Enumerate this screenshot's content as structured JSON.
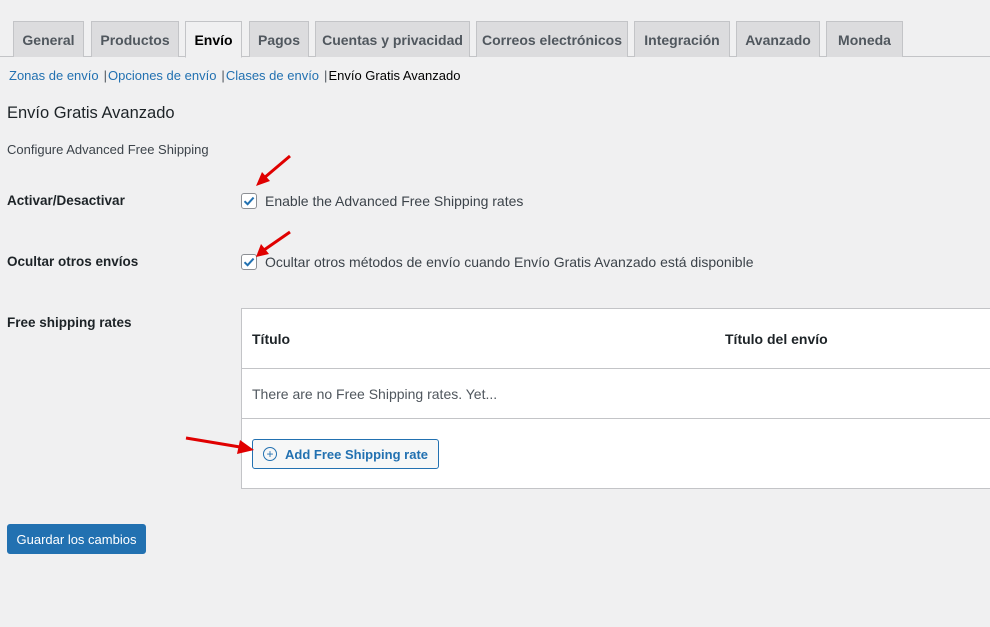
{
  "tabs": [
    {
      "label": "General"
    },
    {
      "label": "Productos"
    },
    {
      "label": "Envío"
    },
    {
      "label": "Pagos"
    },
    {
      "label": "Cuentas y privacidad"
    },
    {
      "label": "Correos electrónicos"
    },
    {
      "label": "Integración"
    },
    {
      "label": "Avanzado"
    },
    {
      "label": "Moneda"
    }
  ],
  "subnav": {
    "zones": "Zonas de envío",
    "options": "Opciones de envío",
    "classes": "Clases de envío",
    "current": "Envío Gratis Avanzado",
    "separator": "|"
  },
  "page": {
    "title": "Envío Gratis Avanzado",
    "description": "Configure Advanced Free Shipping"
  },
  "settings": {
    "enable": {
      "label": "Activar/Desactivar",
      "checkbox_label": "Enable the Advanced Free Shipping rates",
      "checked": true
    },
    "hide_others": {
      "label": "Ocultar otros envíos",
      "checkbox_label": "Ocultar otros métodos de envío cuando Envío Gratis Avanzado está disponible",
      "checked": true
    },
    "rates": {
      "label": "Free shipping rates",
      "columns": [
        "Título",
        "Título del envío"
      ],
      "empty_text": "There are no Free Shipping rates. Yet...",
      "add_button": "Add Free Shipping rate"
    }
  },
  "save_button": "Guardar los cambios",
  "colors": {
    "accent": "#2271b1",
    "annotation_arrow": "#e00000"
  }
}
